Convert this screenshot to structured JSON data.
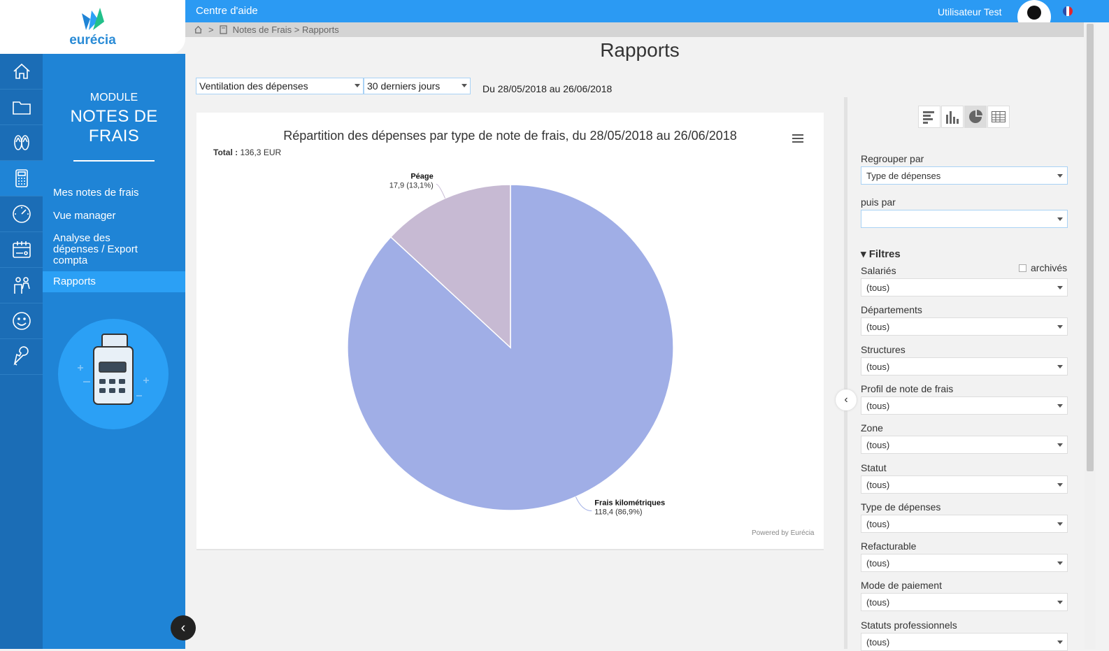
{
  "logo": {
    "text": "eurécia"
  },
  "topbar": {
    "help": "Centre d'aide",
    "user": "Utilisateur  Test"
  },
  "breadcrumb": {
    "sep": ">",
    "path": "Notes de Frais > Rapports"
  },
  "sidebar": {
    "module_label": "MODULE",
    "module_name": "NOTES DE FRAIS",
    "icons": [
      "home-icon",
      "folder-icon",
      "flip-flops-icon",
      "calculator-icon",
      "gauge-icon",
      "calendar-icon",
      "people-icon",
      "smiley-icon",
      "wrench-icon"
    ],
    "items": [
      {
        "label": "Mes notes de frais"
      },
      {
        "label": "Vue manager"
      },
      {
        "label": "Analyse des dépenses / Export compta"
      },
      {
        "label": "Rapports"
      }
    ]
  },
  "page": {
    "title": "Rapports"
  },
  "controls": {
    "report_type": "Ventilation des dépenses",
    "period": "30 derniers jours",
    "date_range": "Du 28/05/2018  au 26/06/2018"
  },
  "chart_data": {
    "type": "pie",
    "title": "Répartition des dépenses par type de note de frais, du 28/05/2018 au 26/06/2018",
    "total_label": "Total :",
    "total_value": "136,3 EUR",
    "slices": [
      {
        "name": "Frais kilométriques",
        "value": 118.4,
        "label": "118,4 (86,9%)",
        "color": "#a0aee6"
      },
      {
        "name": "Péage",
        "value": 17.9,
        "label": "17,9 (13,1%)",
        "color": "#c7bad3"
      }
    ],
    "credit": "Powered by Eurécia"
  },
  "panel": {
    "group_by_label": "Regrouper par",
    "group_by_value": "Type de dépenses",
    "then_by_label": "puis par",
    "then_by_value": "",
    "filters_title": "Filtres",
    "archived_label": "archivés",
    "filters": [
      {
        "label": "Salariés",
        "value": "(tous)"
      },
      {
        "label": "Départements",
        "value": "(tous)"
      },
      {
        "label": "Structures",
        "value": "(tous)"
      },
      {
        "label": "Profil de note de frais",
        "value": "(tous)"
      },
      {
        "label": "Zone",
        "value": "(tous)"
      },
      {
        "label": "Statut",
        "value": "(tous)"
      },
      {
        "label": "Type de dépenses",
        "value": "(tous)"
      },
      {
        "label": "Refacturable",
        "value": "(tous)"
      },
      {
        "label": "Mode de paiement",
        "value": "(tous)"
      },
      {
        "label": "Statuts professionnels",
        "value": "(tous)"
      }
    ]
  },
  "colors": {
    "primary": "#2b9af3",
    "sidebar": "#1f84d6",
    "iconbar": "#1b6db6"
  }
}
